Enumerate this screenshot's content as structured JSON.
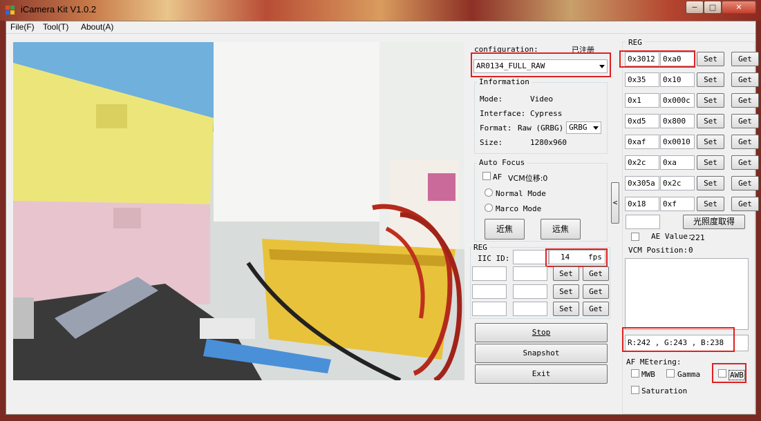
{
  "window": {
    "title": "iCamera Kit V1.0.2",
    "controls": {
      "minimize": "−",
      "maximize": "□",
      "close": "✕"
    }
  },
  "menu": [
    "File(F)",
    "Tool(T)",
    "About(A)"
  ],
  "config": {
    "label": "configuration:",
    "registered": "已注册",
    "selected": "AR0134_FULL_RAW"
  },
  "information": {
    "title": "Information",
    "mode_label": "Mode:",
    "mode_value": "Video",
    "interface_label": "Interface:",
    "interface_value": "Cypress",
    "format_label": "Format:",
    "format_value": "Raw (GRBG)",
    "format_select": "GRBG",
    "size_label": "Size:",
    "size_value": "1280x960"
  },
  "autofocus": {
    "title": "Auto Focus",
    "af_label": "AF",
    "vcm_label": "VCM位移:0",
    "normal_mode": "Normal Mode",
    "marco_mode": "Marco Mode",
    "near_button": "近焦",
    "far_button": "远焦"
  },
  "iic": {
    "title": "REG",
    "iic_label": "IIC ID:",
    "fps_value": "14",
    "fps_unit": "fps",
    "set": "Set",
    "get": "Get"
  },
  "actions": {
    "stop": "Stop",
    "snapshot": "Snapshot",
    "exit": "Exit"
  },
  "collapse_arrow": "<",
  "reg": {
    "title": "REG",
    "set": "Set",
    "get": "Get",
    "rows": [
      {
        "addr": "0x3012",
        "value": "0xa0"
      },
      {
        "addr": "0x35",
        "value": "0x10"
      },
      {
        "addr": "0x1",
        "value": "0x000c"
      },
      {
        "addr": "0xd5",
        "value": "0x800"
      },
      {
        "addr": "0xaf",
        "value": "0x0010"
      },
      {
        "addr": "0x2c",
        "value": "0xa"
      },
      {
        "addr": "0x305a",
        "value": "0x2c"
      },
      {
        "addr": "0x18",
        "value": "0xf"
      }
    ],
    "light_button": "光照度取得"
  },
  "ae": {
    "label": "AE Value:",
    "value": "221"
  },
  "vcm": {
    "label": "VCM Position:",
    "value": "0"
  },
  "rgb": {
    "text": "R:242 , G:243 , B:238"
  },
  "af_metering": {
    "title": "AF MEtering:",
    "mwb": "MWB",
    "gamma": "Gamma",
    "awb": "AWB",
    "saturation": "Saturation"
  },
  "colors": {
    "highlight": "#e02020",
    "window_bg": "#f0f0f0"
  }
}
